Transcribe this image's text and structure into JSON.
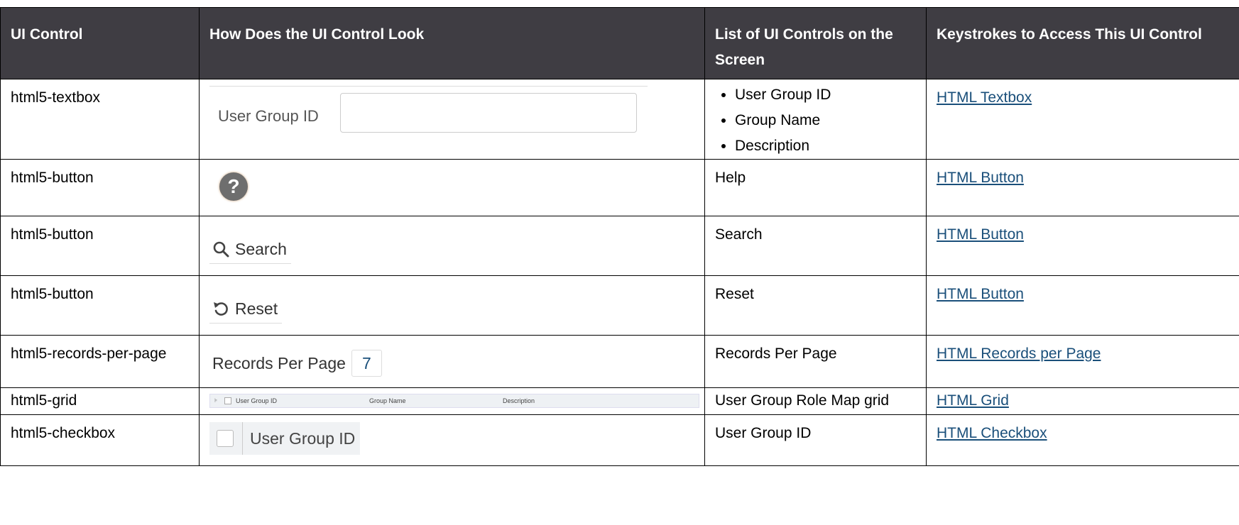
{
  "headers": {
    "c1": "UI Control",
    "c2": "How Does the UI Control Look",
    "c3": "List of UI Controls on the Screen",
    "c4": "Keystrokes to Access This UI Control"
  },
  "rows": [
    {
      "control": "html5-textbox",
      "preview_label": "User Group ID",
      "list": [
        "User Group ID",
        "Group Name",
        "Description"
      ],
      "link": "HTML Textbox"
    },
    {
      "control": "html5-button",
      "preview_icon": "help-icon",
      "preview_glyph": "?",
      "list_text": "Help",
      "link": "HTML Button"
    },
    {
      "control": "html5-button",
      "preview_icon": "search-icon",
      "preview_label": "Search",
      "list_text": "Search",
      "link": "HTML Button"
    },
    {
      "control": "html5-button",
      "preview_icon": "reset-icon",
      "preview_label": "Reset",
      "list_text": "Reset",
      "link": "HTML Button"
    },
    {
      "control": "html5-records-per-page",
      "preview_label": "Records Per Page",
      "preview_value": "7",
      "list_text": "Records Per Page",
      "link": "HTML Records per Page"
    },
    {
      "control": "html5-grid",
      "preview_columns": [
        "User Group ID",
        "Group Name",
        "Description"
      ],
      "list_text": "User Group Role Map grid",
      "link": "HTML Grid"
    },
    {
      "control": "html5-checkbox",
      "preview_label": "User Group ID",
      "list_text": "User Group ID",
      "link": "HTML Checkbox"
    }
  ],
  "colors": {
    "header_bg": "#3f3d43",
    "link": "#1a4f7a"
  }
}
